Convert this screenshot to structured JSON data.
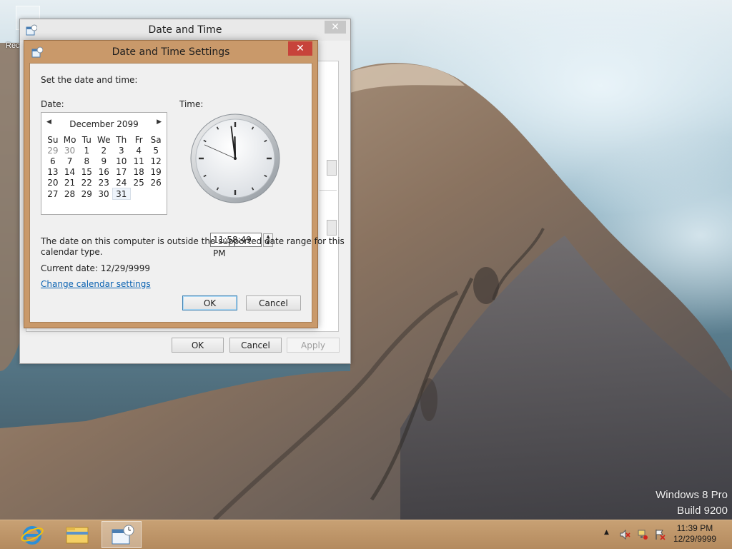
{
  "desktop": {
    "icon_label": "Rec",
    "watermark_os": "Windows 8 Pro",
    "watermark_build": "Build 9200"
  },
  "parent_window": {
    "title": "Date and Time",
    "close_glyph": "✕",
    "ok_label": "OK",
    "cancel_label": "Cancel",
    "apply_label": "Apply"
  },
  "settings_dialog": {
    "title": "Date and Time Settings",
    "close_glyph": "✕",
    "intro": "Set the date and time:",
    "date_label": "Date:",
    "time_label": "Time:",
    "calendar": {
      "month_year": "December 2099",
      "prev_arrow": "◀",
      "next_arrow": "▶",
      "weekdays": [
        "Su",
        "Mo",
        "Tu",
        "We",
        "Th",
        "Fr",
        "Sa"
      ],
      "weeks": [
        [
          "29",
          "30",
          "1",
          "2",
          "3",
          "4",
          "5"
        ],
        [
          "6",
          "7",
          "8",
          "9",
          "10",
          "11",
          "12"
        ],
        [
          "13",
          "14",
          "15",
          "16",
          "17",
          "18",
          "19"
        ],
        [
          "20",
          "21",
          "22",
          "23",
          "24",
          "25",
          "26"
        ],
        [
          "27",
          "28",
          "29",
          "30",
          "31",
          "",
          ""
        ]
      ],
      "dimmed_days": [
        "29",
        "30"
      ],
      "selected_day": "31"
    },
    "clock": {
      "hour": 11,
      "minute": 58,
      "second": 49
    },
    "time_value": "11:58:49 PM",
    "warning_line1": "The date on this computer is outside the supported date range for this",
    "warning_line2": "calendar type.",
    "current_date": "Current date: 12/29/9999",
    "change_calendar_link": "Change calendar settings",
    "ok_label": "OK",
    "cancel_label": "Cancel"
  },
  "taskbar": {
    "apps": [
      "internet-explorer-icon",
      "file-explorer-icon",
      "date-time-settings-icon"
    ],
    "clock_time": "11:39 PM",
    "clock_date": "12/29/9999",
    "show_hidden_glyph": "▲"
  },
  "colors": {
    "dialog_frame": "#c9996a",
    "taskbar": "#b48a5e",
    "link": "#0b63b2",
    "close_red": "#c7433a"
  }
}
